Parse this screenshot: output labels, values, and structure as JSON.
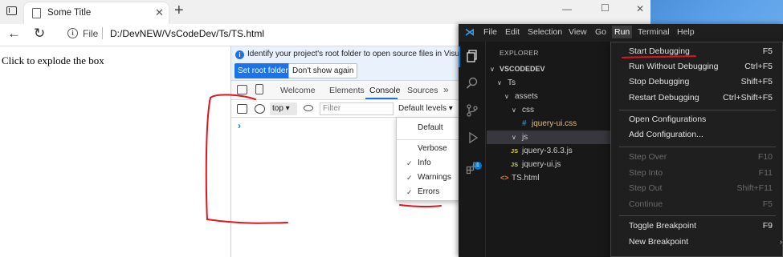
{
  "browser": {
    "tab_title": "Some Title",
    "address_scheme": "File",
    "address_url": "D:/DevNEW/VsCodeDev/Ts/TS.html",
    "page_text": "Click to explode the box"
  },
  "devtools": {
    "info_text": "Identify your project's root folder to open source files in Visual Stu",
    "set_root_button": "Set root folder",
    "dont_show_button": "Don't show again",
    "tabs": [
      "Welcome",
      "Elements",
      "Console",
      "Sources"
    ],
    "active_tab": "Console",
    "context_select": "top",
    "filter_placeholder": "Filter",
    "levels_label": "Default levels",
    "prompt_symbol": "›",
    "levels_menu": {
      "default": "Default",
      "items": [
        {
          "label": "Verbose",
          "checked": false
        },
        {
          "label": "Info",
          "checked": true
        },
        {
          "label": "Warnings",
          "checked": true
        },
        {
          "label": "Errors",
          "checked": true
        }
      ]
    }
  },
  "vscode": {
    "menus": [
      "File",
      "Edit",
      "Selection",
      "View",
      "Go",
      "Run",
      "Terminal",
      "Help"
    ],
    "explorer_title": "EXPLORER",
    "tree": {
      "root": "VSCODEDEV",
      "ts": "Ts",
      "assets": "assets",
      "css": "css",
      "jquery_ui_css": "jquery-ui.css",
      "js": "js",
      "jquery": "jquery-3.6.3.js",
      "jquery_ui_js": "jquery-ui.js",
      "ts_html": "TS.html"
    },
    "badge_count": "1",
    "run_menu": [
      {
        "label": "Start Debugging",
        "shortcut": "F5",
        "disabled": false
      },
      {
        "label": "Run Without Debugging",
        "shortcut": "Ctrl+F5",
        "disabled": false
      },
      {
        "label": "Stop Debugging",
        "shortcut": "Shift+F5",
        "disabled": false
      },
      {
        "label": "Restart Debugging",
        "shortcut": "Ctrl+Shift+F5",
        "disabled": false
      },
      {
        "label": "Open Configurations",
        "shortcut": "",
        "disabled": false
      },
      {
        "label": "Add Configuration...",
        "shortcut": "",
        "disabled": false
      },
      {
        "label": "Step Over",
        "shortcut": "F10",
        "disabled": true
      },
      {
        "label": "Step Into",
        "shortcut": "F11",
        "disabled": true
      },
      {
        "label": "Step Out",
        "shortcut": "Shift+F11",
        "disabled": true
      },
      {
        "label": "Continue",
        "shortcut": "F5",
        "disabled": true
      },
      {
        "label": "Toggle Breakpoint",
        "shortcut": "F9",
        "disabled": false
      },
      {
        "label": "New Breakpoint",
        "shortcut": "",
        "disabled": false
      }
    ]
  },
  "colors": {
    "accent": "#1a73e8",
    "annotation": "#e0141e",
    "vscode_bg": "#181818"
  }
}
